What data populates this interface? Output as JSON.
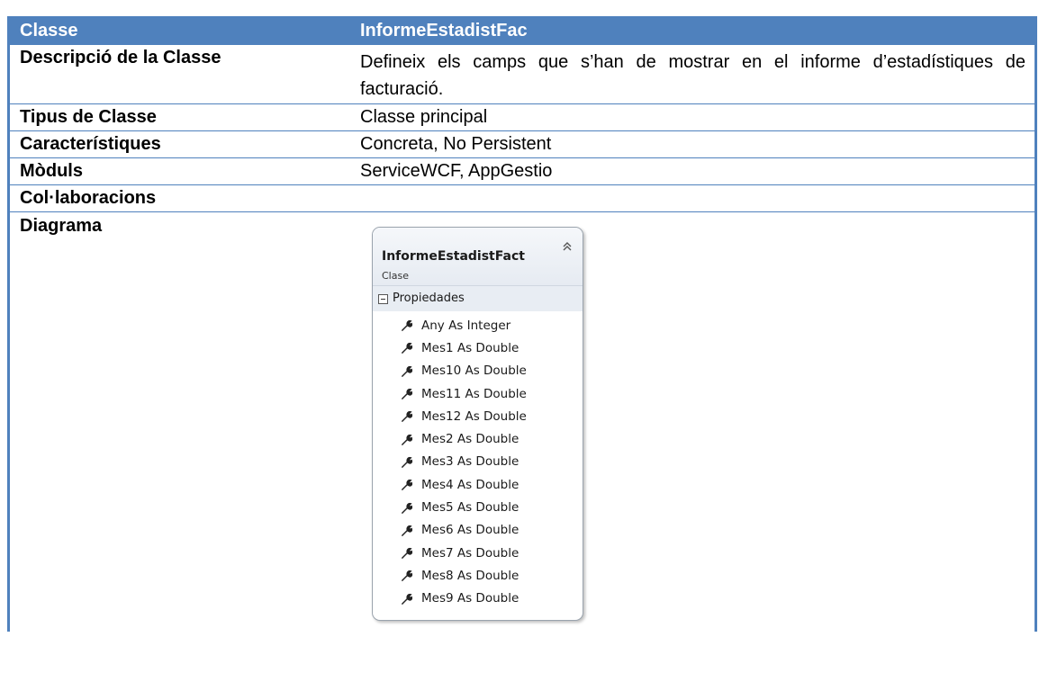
{
  "table": {
    "header": {
      "label": "Classe",
      "value": "InformeEstadistFac"
    },
    "rows": [
      {
        "label": "Descripció de la Classe",
        "value": "Defineix els camps que s’han de mostrar en el informe d’estadístiques de facturació."
      },
      {
        "label": "Tipus de Classe",
        "value": "Classe principal"
      },
      {
        "label": "Característiques",
        "value": "Concreta, No Persistent"
      },
      {
        "label": "Mòduls",
        "value": "ServiceWCF, AppGestio"
      },
      {
        "label": "Col·laboracions",
        "value": ""
      },
      {
        "label": "Diagrama",
        "value": ""
      }
    ]
  },
  "diagram": {
    "class_name": "InformeEstadistFact",
    "stereotype": "Clase",
    "section_title": "Propiedades",
    "properties": [
      "Any As Integer",
      "Mes1 As Double",
      "Mes10 As Double",
      "Mes11 As Double",
      "Mes12 As Double",
      "Mes2 As Double",
      "Mes3 As Double",
      "Mes4 As Double",
      "Mes5 As Double",
      "Mes6 As Double",
      "Mes7 As Double",
      "Mes8 As Double",
      "Mes9 As Double"
    ],
    "icons": {
      "collapse": "double-chevron-up-icon",
      "section_toggle": "minus-box-icon",
      "property": "wrench-icon"
    }
  },
  "colors": {
    "header_bg": "#4f81bd",
    "header_text": "#ffffff",
    "border": "#4f81bd"
  }
}
